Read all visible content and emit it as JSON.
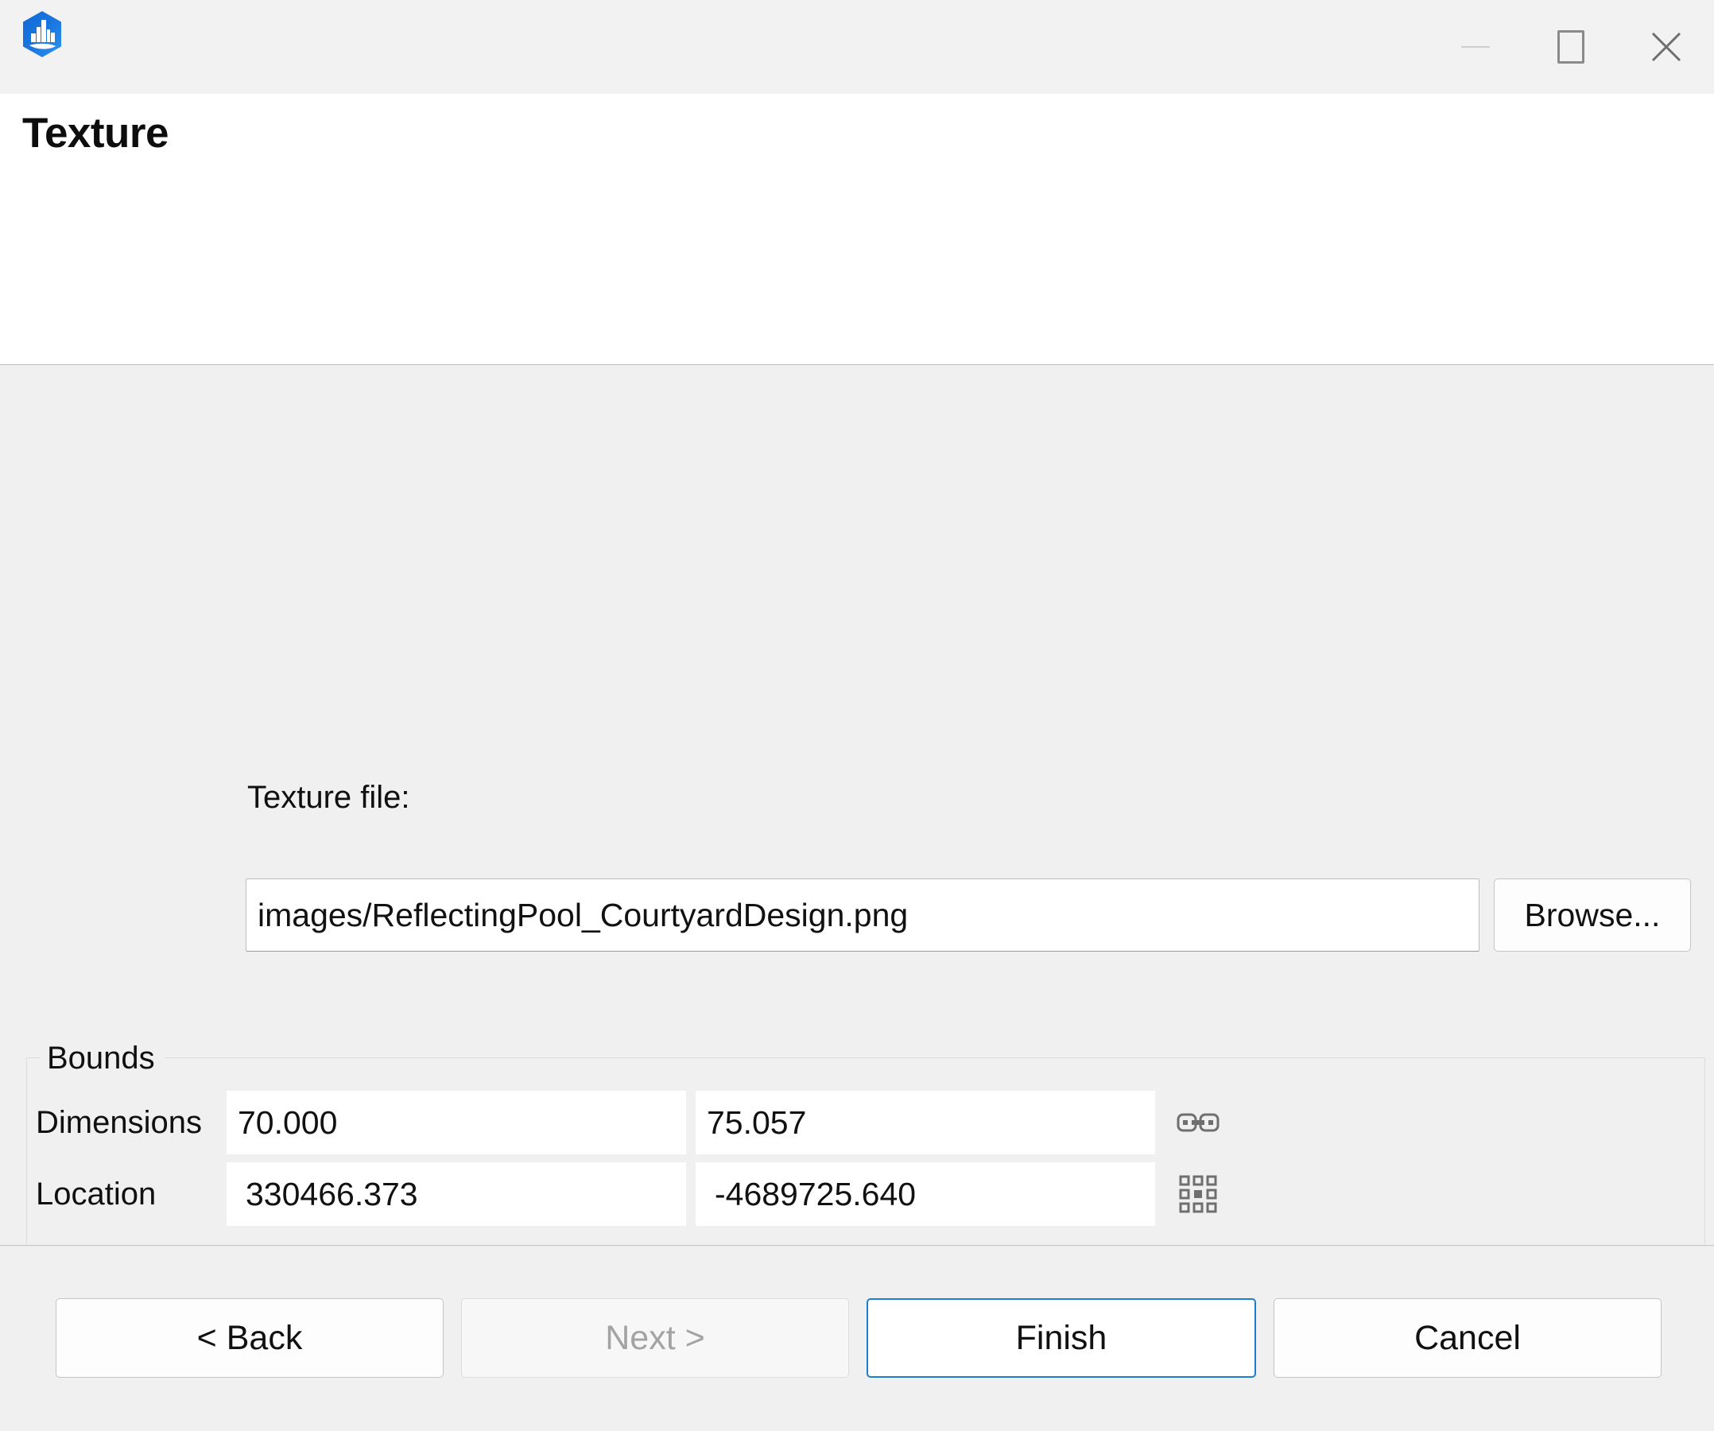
{
  "window": {
    "app_icon": "city-skyline-hexagon-icon",
    "controls": {
      "minimize": "minimize-icon",
      "maximize": "maximize-icon",
      "close": "close-icon"
    }
  },
  "header": {
    "title": "Texture",
    "description": ""
  },
  "form": {
    "file_label": "Texture file:",
    "file_value": "images/ReflectingPool_CourtyardDesign.png",
    "file_placeholder": "",
    "browse_label": "Browse..."
  },
  "bounds": {
    "group_title": "Bounds",
    "rows": [
      {
        "label": "Dimensions",
        "value_x": "70.000",
        "value_y": "75.057",
        "icon": "link-chain-icon"
      },
      {
        "label": "Location",
        "value_x": "330466.373",
        "value_y": "-4689725.640",
        "icon": "anchor-handles-icon"
      }
    ]
  },
  "footer": {
    "back_label": "< Back",
    "next_label": "Next >",
    "finish_label": "Finish",
    "cancel_label": "Cancel"
  },
  "colors": {
    "accent": "#1a7fd4",
    "titlebar_bg": "#f2f2f2",
    "content_bg": "#f0f0f0",
    "header_bg": "#ffffff",
    "text": "#111111",
    "disabled_text": "#a3a3a3"
  }
}
